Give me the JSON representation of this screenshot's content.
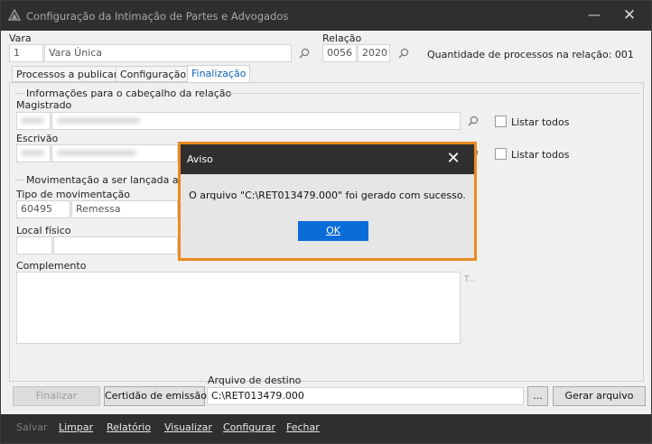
{
  "window": {
    "title": "Configuração da Intimação de Partes e Advogados",
    "minimize_glyph": "—",
    "close_glyph": "✕"
  },
  "vara": {
    "label": "Vara",
    "code": "1",
    "name": "Vara Única"
  },
  "relacao": {
    "label": "Relação",
    "number": "0056",
    "year": "2020",
    "quantity_text": "Quantidade de processos na relação: 001"
  },
  "tabs": [
    {
      "label": "Processos a publicar",
      "active": false
    },
    {
      "label": "Configuração",
      "active": false
    },
    {
      "label": "Finalização",
      "active": true
    }
  ],
  "header_group": {
    "title": "Informações para o cabeçalho da relação",
    "magistrado_label": "Magistrado",
    "escrivao_label": "Escrivão",
    "listar_todos_label": "Listar todos"
  },
  "movement_group": {
    "title": "Movimentação a ser lançada ao fi",
    "tipo_label": "Tipo de movimentação",
    "tipo_code": "60495",
    "tipo_name": "Remessa",
    "local_label": "Local físico",
    "complemento_label": "Complemento",
    "complemento_hint": "T..."
  },
  "destino": {
    "label": "Arquivo de destino",
    "value": "C:\\RET013479.000",
    "browse_label": "..."
  },
  "buttons": {
    "finalizar": "Finalizar",
    "certidao": "Certidão de emissão",
    "gerar": "Gerar arquivo"
  },
  "bottom_menu": [
    {
      "label": "Salvar",
      "disabled": true
    },
    {
      "label": "Limpar",
      "disabled": false
    },
    {
      "label": "Relatório",
      "disabled": false
    },
    {
      "label": "Visualizar",
      "disabled": false
    },
    {
      "label": "Configurar",
      "disabled": false
    },
    {
      "label": "Fechar",
      "disabled": false
    }
  ],
  "dialog": {
    "title": "Aviso",
    "message": "O arquivo \"C:\\RET013479.000\" foi gerado com sucesso.",
    "ok_label": "OK",
    "accent": "#e98a20"
  }
}
